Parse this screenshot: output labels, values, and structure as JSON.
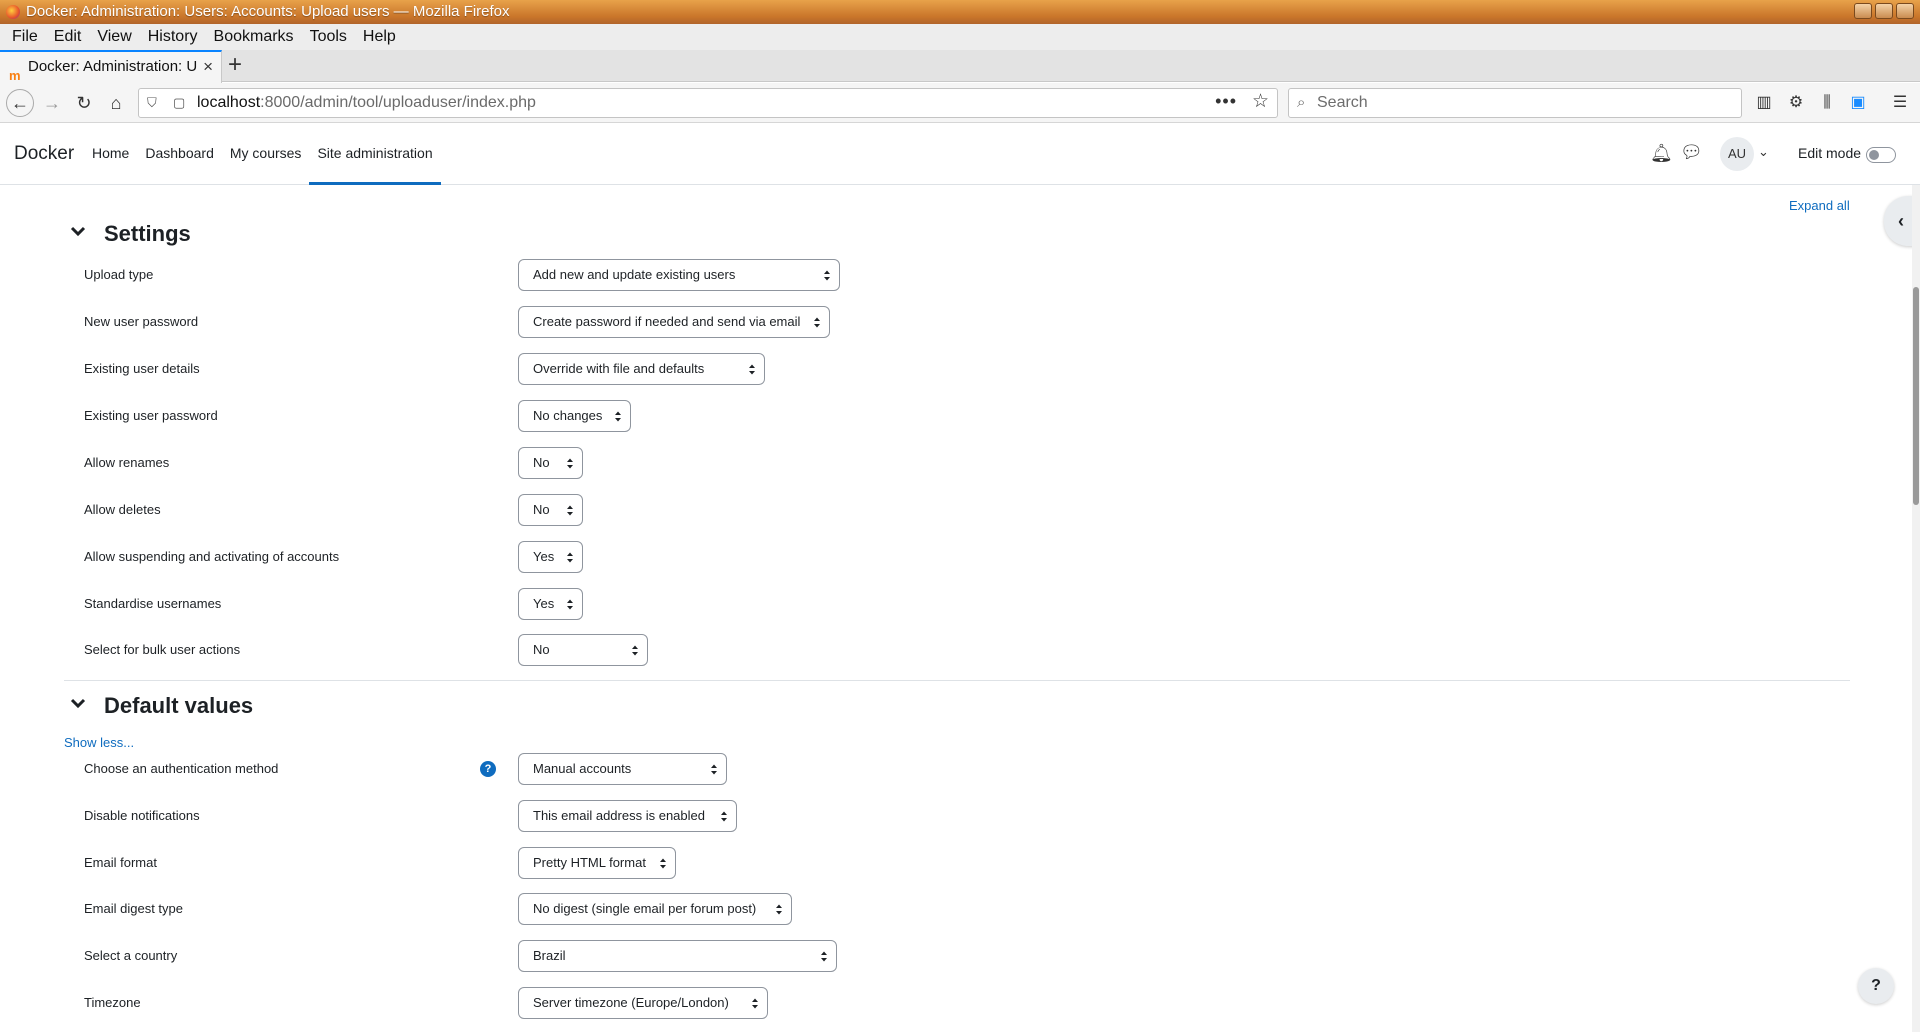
{
  "browser": {
    "window_title": "Docker: Administration: Users: Accounts: Upload users — Mozilla Firefox",
    "menu": [
      "File",
      "Edit",
      "View",
      "History",
      "Bookmarks",
      "Tools",
      "Help"
    ],
    "tab_title": "Docker: Administration: U",
    "url_host": "localhost",
    "url_rest": ":8000/admin/tool/uploaduser/index.php",
    "search_placeholder": "Search"
  },
  "moodle": {
    "brand": "Docker",
    "nav": [
      "Home",
      "Dashboard",
      "My courses",
      "Site administration"
    ],
    "active_nav": "Site administration",
    "avatar_initials": "AU",
    "edit_mode_label": "Edit mode",
    "edit_mode_on": false,
    "expand_all": "Expand all",
    "show_less": "Show less..."
  },
  "settings": {
    "title": "Settings",
    "rows": [
      {
        "label": "Upload type",
        "value": "Add new and update existing users"
      },
      {
        "label": "New user password",
        "value": "Create password if needed and send via email"
      },
      {
        "label": "Existing user details",
        "value": "Override with file and defaults"
      },
      {
        "label": "Existing user password",
        "value": "No changes"
      },
      {
        "label": "Allow renames",
        "value": "No"
      },
      {
        "label": "Allow deletes",
        "value": "No"
      },
      {
        "label": "Allow suspending and activating of accounts",
        "value": "Yes"
      },
      {
        "label": "Standardise usernames",
        "value": "Yes"
      },
      {
        "label": "Select for bulk user actions",
        "value": "No"
      }
    ]
  },
  "default_values": {
    "title": "Default values",
    "rows": [
      {
        "label": "Choose an authentication method",
        "value": "Manual accounts",
        "help": "?"
      },
      {
        "label": "Disable notifications",
        "value": "This email address is enabled"
      },
      {
        "label": "Email format",
        "value": "Pretty HTML format"
      },
      {
        "label": "Email digest type",
        "value": "No digest (single email per forum post)"
      },
      {
        "label": "Select a country",
        "value": "Brazil"
      },
      {
        "label": "Timezone",
        "value": "Server timezone (Europe/London)"
      }
    ]
  },
  "help_button": "?",
  "colors": {
    "link": "#0f6cbf",
    "text": "#1d2125",
    "border": "#8f959e"
  }
}
